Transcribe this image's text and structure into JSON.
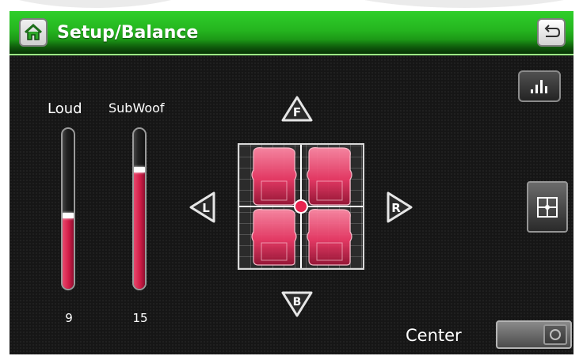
{
  "header": {
    "title": "Setup/Balance",
    "home_icon": "home-icon",
    "back_icon": "back-icon"
  },
  "sliders": [
    {
      "label": "Loud",
      "value": "9",
      "level": 0.45
    },
    {
      "label": "SubWoof",
      "value": "15",
      "level": 0.75
    }
  ],
  "balance": {
    "front": "F",
    "back": "B",
    "left": "L",
    "right": "R"
  },
  "right_panel": {
    "eq_icon": "equalizer-icon",
    "balance_icon": "balance-grid-icon"
  },
  "center": {
    "label": "Center",
    "toggle_state": "off"
  },
  "colors": {
    "header_green": "#25b51f",
    "accent_red": "#d21d48",
    "background": "#161616"
  }
}
